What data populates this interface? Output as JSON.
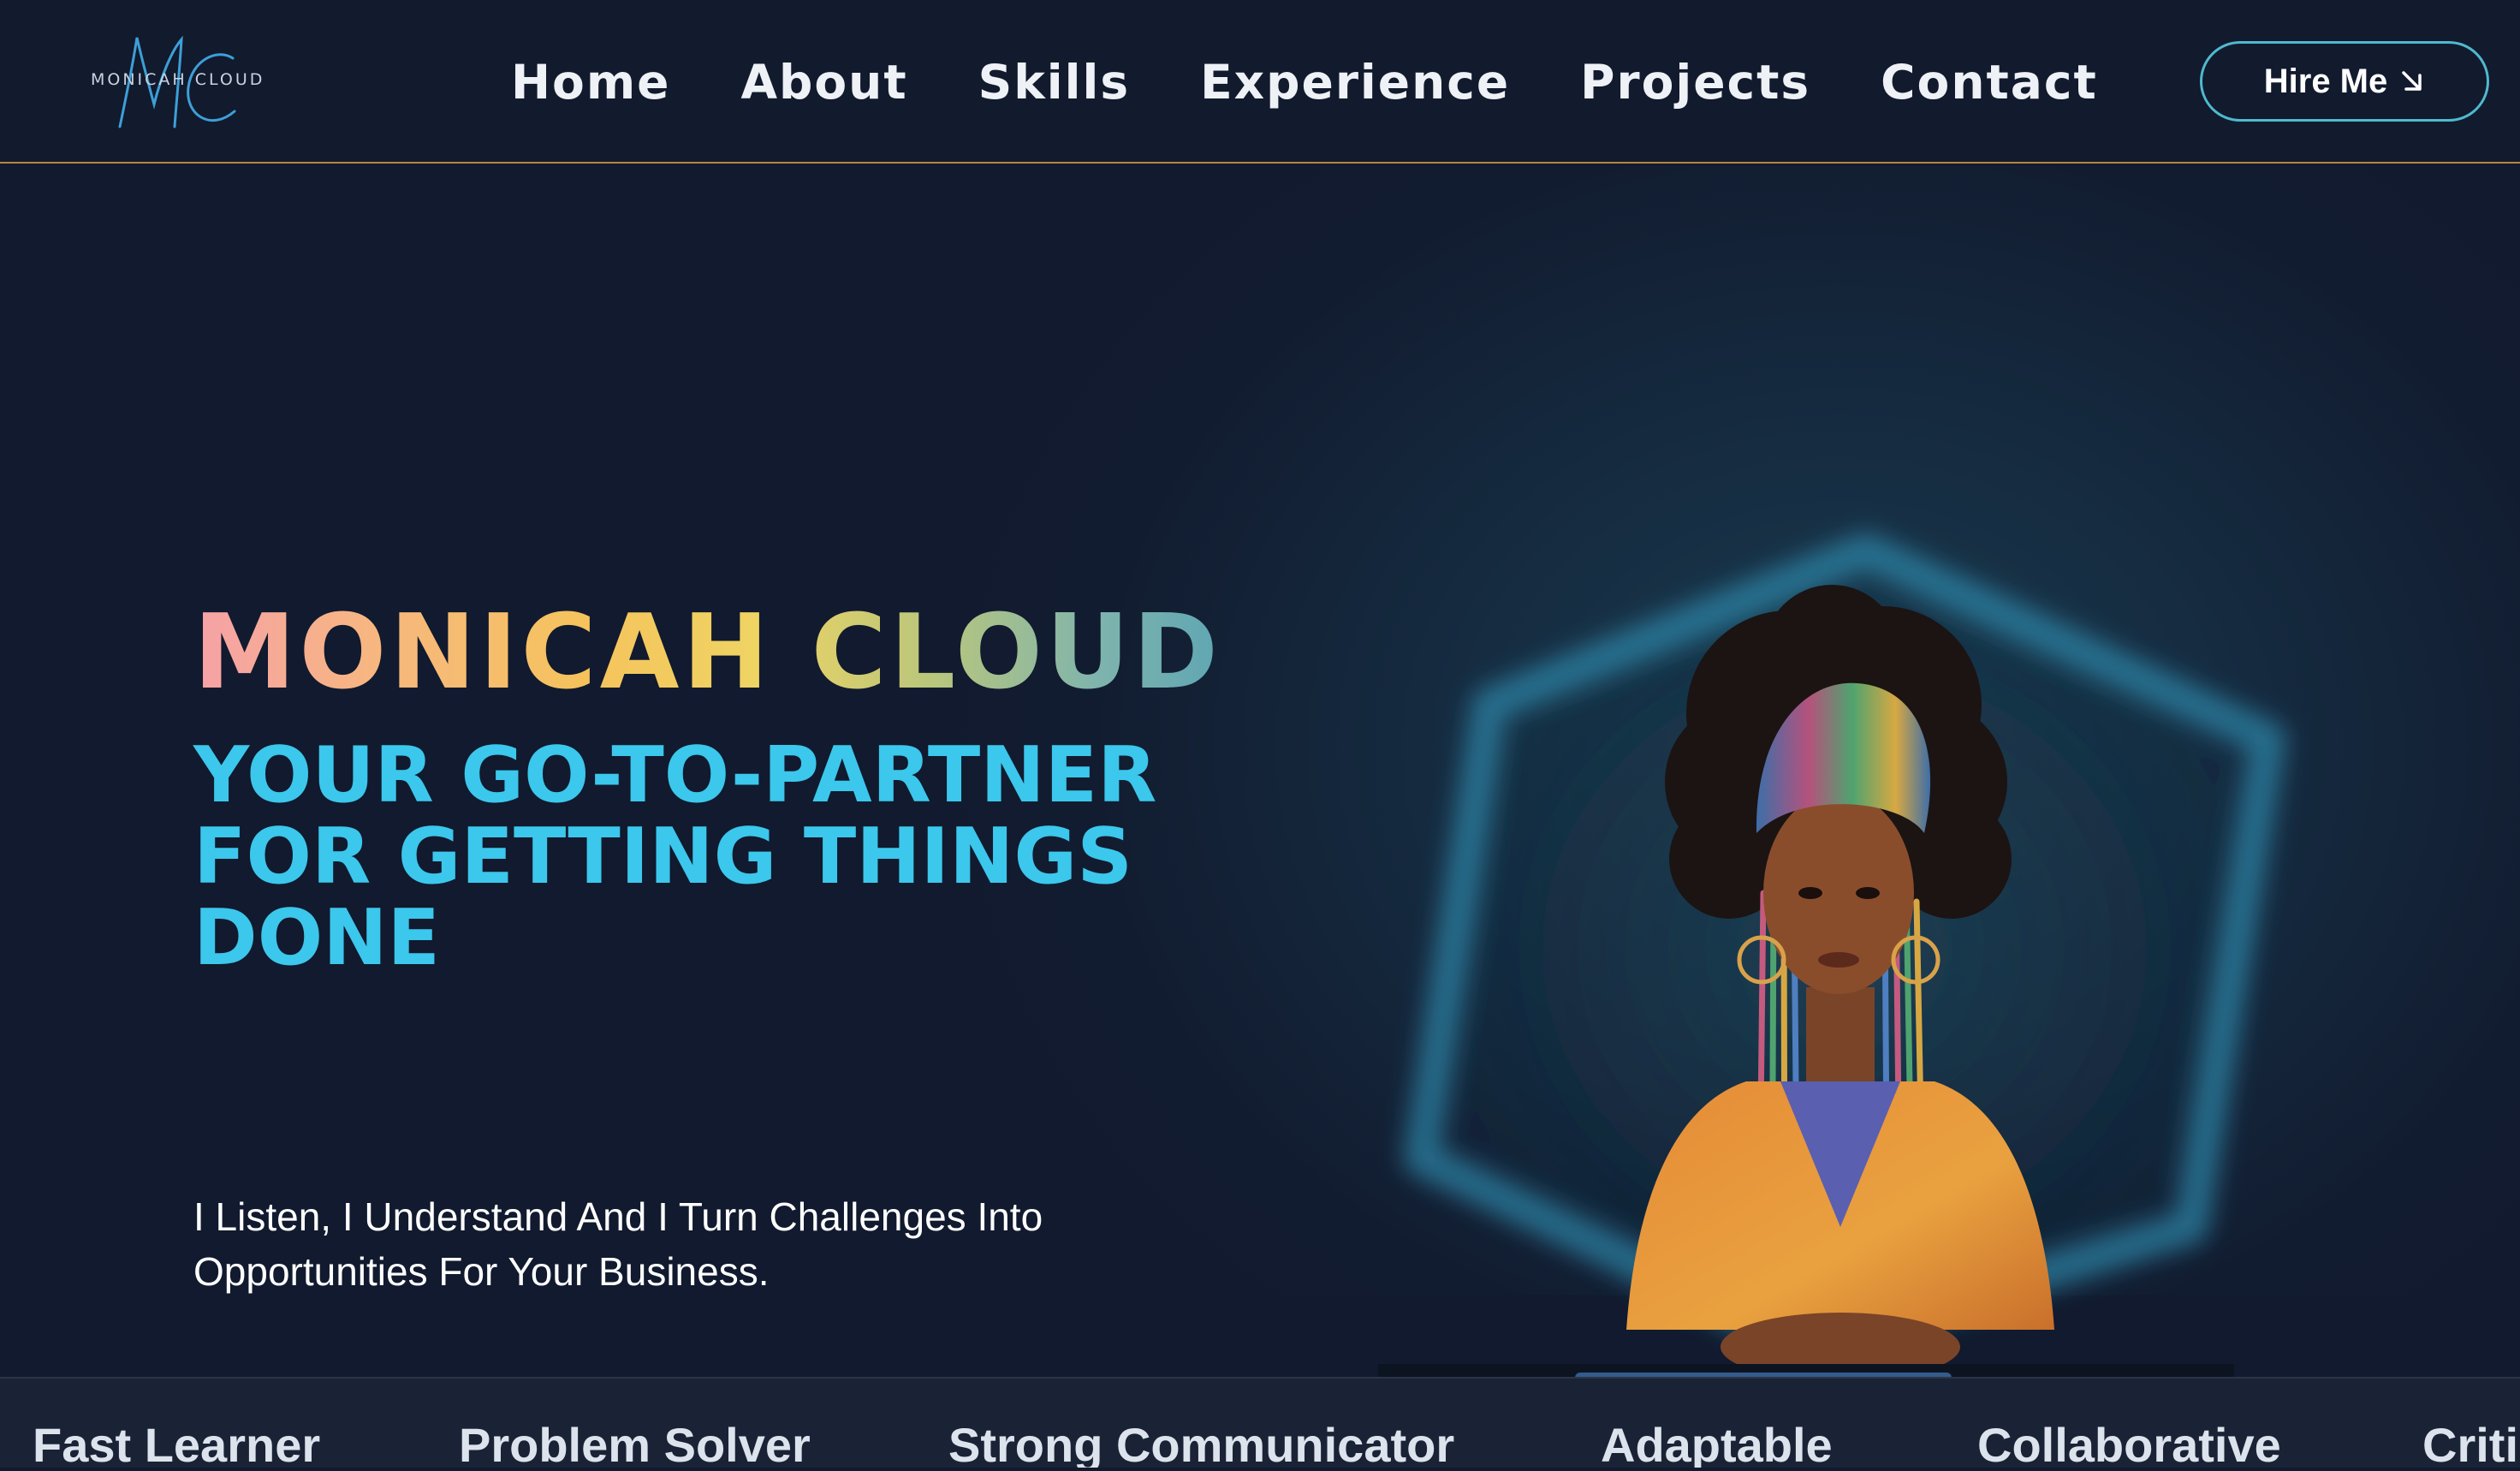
{
  "header": {
    "logo_text": "MONICAH CLOUD",
    "nav": [
      {
        "label": "Home"
      },
      {
        "label": "About"
      },
      {
        "label": "Skills"
      },
      {
        "label": "Experience"
      },
      {
        "label": "Projects"
      },
      {
        "label": "Contact"
      }
    ],
    "cta_label": "Hire Me",
    "cta_icon": "arrow-down-right-icon"
  },
  "hero": {
    "name": "MONICAH CLOUD",
    "tagline": "YOUR GO-TO-PARTNER FOR GETTING THINGS DONE",
    "description": "I Listen, I Understand And I Turn Challenges Into Opportunities For Your Business.",
    "illustration": "portrait-illustration"
  },
  "traits": [
    "Fast Learner",
    "Problem Solver",
    "Strong Communicator",
    "Adaptable",
    "Collaborative",
    "Criti"
  ],
  "colors": {
    "background": "#111a2e",
    "accent_cyan": "#3cc7ec",
    "header_border": "#b8863a",
    "button_border": "#4fb9cf"
  }
}
